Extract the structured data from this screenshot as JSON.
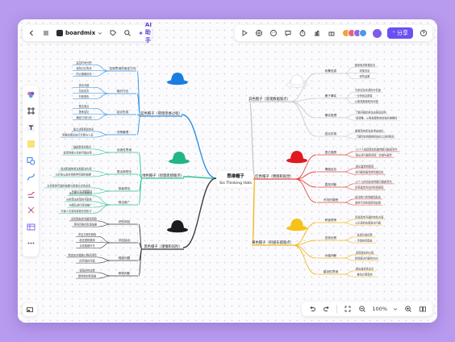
{
  "toolbar": {
    "brand": "boardmix",
    "ai_label": "AI助手",
    "share_label": "分享"
  },
  "zoom": {
    "level": "100%"
  },
  "central": {
    "title": "思维帽子",
    "subtitle": "Six Thinking Hats"
  },
  "branches": {
    "blue": {
      "label": "蓝色帽子（管理思维过程）",
      "color": "#2f8fe0",
      "hat_color": "#1a7de0",
      "items": [
        {
          "label": "控制思维的各定方向",
          "leaves": [
            "监控时间分配",
            "保持讨论有效",
            "防止偏离目标"
          ]
        },
        {
          "label": "组织讨论",
          "leaves": [
            "提出问题",
            "总结发言",
            "分配角色"
          ]
        },
        {
          "label": "结论形成",
          "leaves": [
            "整合观点",
            "提炼结论",
            "确定行动计划"
          ]
        },
        {
          "label": "决策管理",
          "leaves": [
            "建立决策规则体系",
            "明确决策后执行步骤与人员"
          ]
        }
      ]
    },
    "white": {
      "label": "白色帽子（客观数据观点）",
      "color": "#b9bcc6",
      "hat_color": "#ffffff",
      "items": [
        {
          "label": "收集信息",
          "leaves": [
            "搜索相关数据信息",
            "收集信息",
            "研究结果"
          ]
        },
        {
          "label": "基于事实",
          "leaves": [
            "分析信息来源的可信度",
            "分析信息质量",
            "以客观角度看待问题"
          ]
        },
        {
          "label": "事实推理",
          "leaves": [
            "了解问题的来龙去脉及影响",
            "逻辑推，从各角度检查信息的准确性"
          ]
        },
        {
          "label": "结论形成",
          "leaves": [
            "根据事实和信息得出结论",
            "了解所有的数据和结论之间的联系"
          ]
        }
      ]
    },
    "green": {
      "label": "绿色帽子（创意思想观点）",
      "color": "#2ec393",
      "hat_color": "#22b585",
      "items": [
        {
          "label": "创造性思维",
          "leaves": [
            "鼓励新奇的观点",
            "探索常规以外的可能方案"
          ]
        },
        {
          "label": "提出新想法",
          "leaves": [
            "提出新颖的想法和解决方案",
            "以开放心态对待各种可能的结果"
          ]
        },
        {
          "label": "探索想法",
          "leaves": [
            "分析各种可能的结果与思维方式的关系",
            "与他人交流的想法"
          ]
        },
        {
          "label": "想法推广",
          "leaves": [
            "设计新方法实现想法",
            "分析想法实现的可能性",
            "与团队进行想法推广",
            "与他人交流探索想法的执行"
          ]
        }
      ]
    },
    "red": {
      "label": "红色帽子（情感和直觉）",
      "color": "#e8483e",
      "hat_color": "#e0191f",
      "items": [
        {
          "label": "表达感受",
          "leaves": [
            "以个人的感受和情绪判断问题或事件",
            "表达对问题的感受、情绪与直觉"
          ]
        },
        {
          "label": "情感反应",
          "leaves": [
            "表达直觉和预感",
            "对问题的直觉或情绪反应"
          ]
        },
        {
          "label": "直觉判断",
          "leaves": [
            "以个人的喜好来判断问题或事件",
            "探索直觉背后的情感原因"
          ]
        },
        {
          "label": "不同的感受",
          "leaves": [
            "关注他人的情绪和反应",
            "尊重不同的感受和态度"
          ]
        }
      ]
    },
    "black": {
      "label": "黑色帽子（谨慎和风险）",
      "color": "#3d3d3d",
      "hat_color": "#1c1c1c",
      "items": [
        {
          "label": "识别风险",
          "leaves": [
            "识别潜在的问题和风险",
            "预测可能的负面结果"
          ]
        },
        {
          "label": "评估缺点",
          "leaves": [
            "评估方案的缺陷",
            "检查逻辑漏洞",
            "寻找薄弱环节"
          ]
        },
        {
          "label": "规避问题",
          "leaves": [
            "制定应对措施以降低风险",
            "防范潜在问题"
          ]
        },
        {
          "label": "审慎判断",
          "leaves": [
            "谨慎对待决策",
            "保持批判性思维"
          ]
        }
      ]
    },
    "yellow": {
      "label": "黄色帽子（积极乐观观点）",
      "color": "#f2b81c",
      "hat_color": "#f6c21a",
      "items": [
        {
          "label": "积极思考",
          "leaves": [
            "积极思考问题的有利方面",
            "以乐观的态度面对问题"
          ]
        },
        {
          "label": "发现优势",
          "leaves": [
            "发现方案优势",
            "寻找有利因素"
          ]
        },
        {
          "label": "价值判断",
          "leaves": [
            "发现潜在的价值",
            "找到解决问题的方向"
          ]
        },
        {
          "label": "建设性思维",
          "leaves": [
            "提出建设性意见",
            "推动方案落地"
          ]
        }
      ]
    }
  }
}
